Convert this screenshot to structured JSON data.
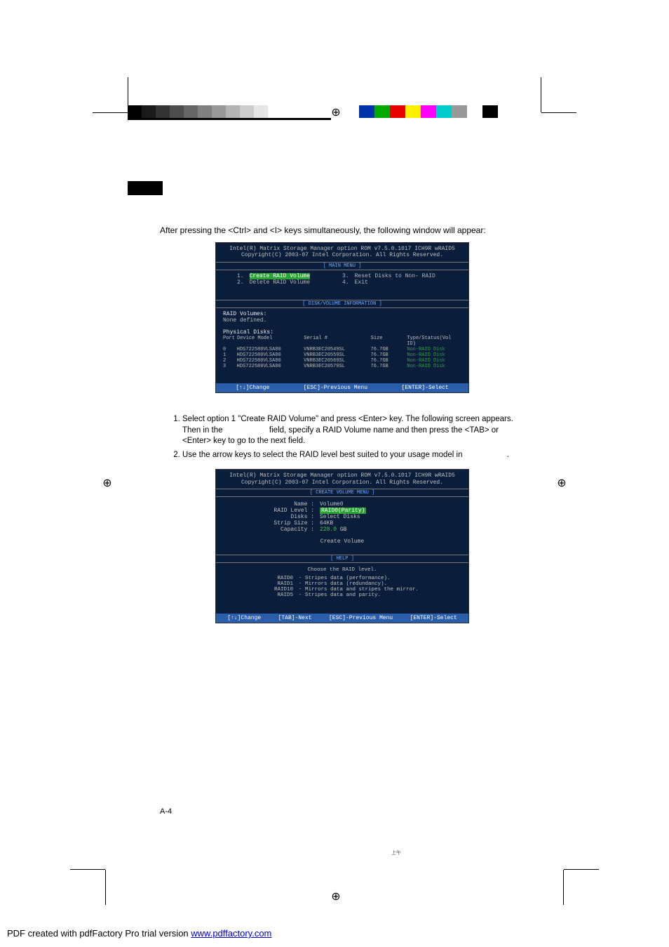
{
  "intro_text": "After pressing the <Ctrl> and <I> keys simultaneously, the following window will appear:",
  "bios": {
    "header_line1": "Intel(R) Matrix Storage Manager option ROM v7.5.0.1017 ICH9R wRAID5",
    "header_line2": "Copyright(C) 2003-07 Intel Corporation. All Rights Reserved.",
    "main_menu_title": "[ MAIN MENU ]",
    "menu": {
      "1": "Create RAID Volume",
      "2": "Delete RAID Volume",
      "3": "Reset Disks to Non- RAID",
      "4": "Exit"
    },
    "disk_info_title": "[ DISK/VOLUME INFORMATION ]",
    "raid_volumes_label": "RAID Volumes:",
    "none_defined": "None defined.",
    "physical_disks_label": "Physical Disks:",
    "phys_header": {
      "port": "Port",
      "model": "Device Model",
      "serial": "Serial #",
      "size": "Size",
      "type": "Type/Status(Vol ID)"
    },
    "disks": [
      {
        "port": "0",
        "model": "HDS722580VLSA80",
        "serial": "VNRB3EC20549SL",
        "size": "76.7GB",
        "type": "Non-RAID Disk"
      },
      {
        "port": "1",
        "model": "HDS722580VLSA80",
        "serial": "VNRB3EC20559SL",
        "size": "76.7GB",
        "type": "Non-RAID Disk"
      },
      {
        "port": "2",
        "model": "HDS722580VLSA80",
        "serial": "VNRB3EC20569SL",
        "size": "76.7GB",
        "type": "Non-RAID Disk"
      },
      {
        "port": "3",
        "model": "HDS722580VLSA80",
        "serial": "VNRB3EC20579SL",
        "size": "76.7GB",
        "type": "Non-RAID Disk"
      }
    ],
    "footer1": {
      "change": "[↑↓]Change",
      "prev": "[ESC]-Previous Menu",
      "select": "[ENTER]-Select"
    }
  },
  "instructions": {
    "item1_a": "Select option 1 \"Create RAID Volume\" and press <Enter> key. The following screen appears. Then in the ",
    "item1_b": " field, specify a RAID Volume name and then press the <TAB> or <Enter> key to go to the next field.",
    "item2_a": "Use the arrow keys to select the RAID level best suited to your usage model in ",
    "item2_b": "."
  },
  "create_menu": {
    "title": "[ CREATE VOLUME MENU ]",
    "name_label": "Name :",
    "name_value": "Volume0",
    "raid_level_label": "RAID Level :",
    "raid_level_value": "RAID0(Parity)",
    "disks_label": "Disks :",
    "disks_value": "Select Disks",
    "strip_size_label": "Strip Size :",
    "strip_size_value": "64KB",
    "capacity_label": "Capacity :",
    "capacity_value_num": "228.0",
    "capacity_value_unit": "GB",
    "create_volume": "Create Volume"
  },
  "help": {
    "title": "[ HELP ]",
    "choose": "Choose the RAID level.",
    "rows": [
      {
        "l": "RAID0",
        "d": "- Stripes data (performance)."
      },
      {
        "l": "RAID1",
        "d": "- Mirrors data (redundancy)."
      },
      {
        "l": "RAID10",
        "d": "- Mirrors data and stripes the mirror."
      },
      {
        "l": "RAID5",
        "d": "- Stripes data and parity."
      }
    ]
  },
  "footer2": {
    "change": "[↑↓]Change",
    "tab": "[TAB]-Next",
    "prev": "[ESC]-Previous Menu",
    "select": "[ENTER]-Select"
  },
  "page_num": "A-4",
  "small_time": "上午",
  "pdf_footer_text": "PDF created with pdfFactory Pro trial version ",
  "pdf_footer_link": "www.pdffactory.com",
  "colors": {
    "left_bar": [
      "#000000",
      "#1a1a1a",
      "#333333",
      "#4d4d4d",
      "#666666",
      "#808080",
      "#999999",
      "#b3b3b3",
      "#cccccc",
      "#e6e6e6",
      "#ffffff"
    ],
    "right_bar": [
      "#0033aa",
      "#00aa00",
      "#e60000",
      "#ffee00",
      "#ff00ff",
      "#00cccc",
      "#999999",
      "#ffffff",
      "#000000"
    ]
  }
}
